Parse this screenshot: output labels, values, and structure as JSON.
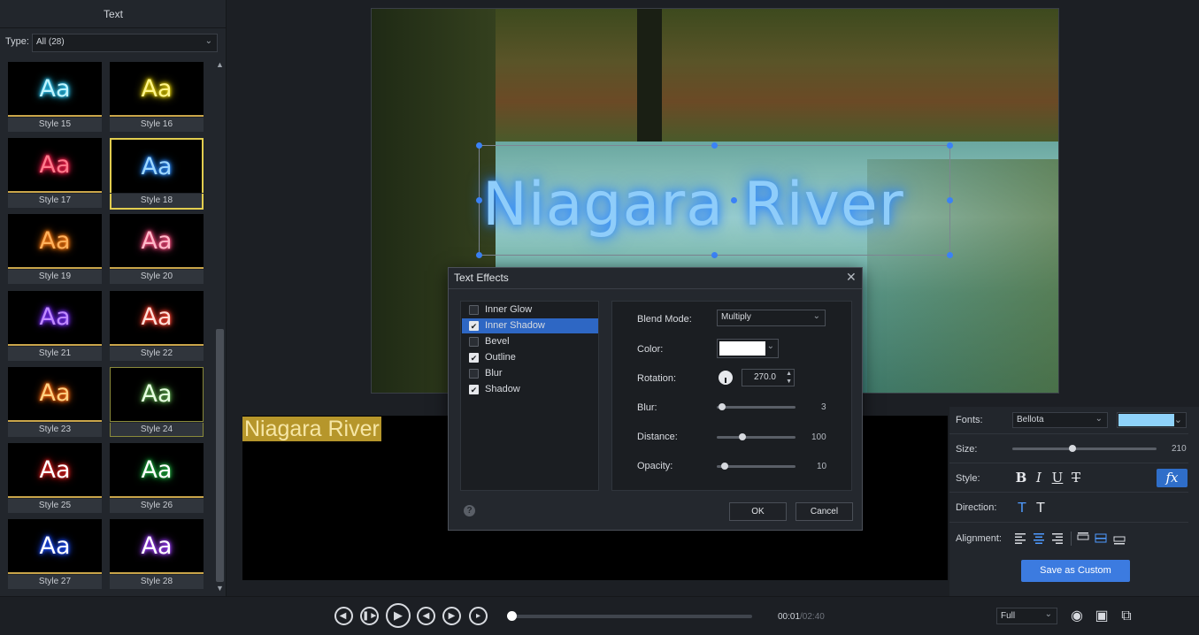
{
  "panel": {
    "title": "Text",
    "type_label": "Type:",
    "type_value": "All (28)"
  },
  "styles": [
    {
      "label": "Style 15",
      "glyph": "Aa",
      "fill": "#bff4ff",
      "glow": "#2fd0ff"
    },
    {
      "label": "Style 16",
      "glyph": "Aa",
      "fill": "#fff58a",
      "glow": "#e6d200"
    },
    {
      "label": "Style 17",
      "glyph": "Aa",
      "fill": "#ff7a8c",
      "glow": "#ff2050"
    },
    {
      "label": "Style 18",
      "glyph": "Aa",
      "fill": "#9fd8ff",
      "glow": "#2a8cff"
    },
    {
      "label": "Style 19",
      "glyph": "Aa",
      "fill": "#ffb05a",
      "glow": "#ff7a10"
    },
    {
      "label": "Style 20",
      "glyph": "Aa",
      "fill": "#ffb8c8",
      "glow": "#ff4d80"
    },
    {
      "label": "Style 21",
      "glyph": "Aa",
      "fill": "#c08aff",
      "glow": "#7a2dff"
    },
    {
      "label": "Style 22",
      "glyph": "Aa",
      "fill": "#ffe0d8",
      "glow": "#ff4030"
    },
    {
      "label": "Style 23",
      "glyph": "Aa",
      "fill": "#ffd080",
      "glow": "#ff6a10"
    },
    {
      "label": "Style 24",
      "glyph": "Aa",
      "fill": "#e6ffe0",
      "glow": "#58a04a"
    },
    {
      "label": "Style 25",
      "glyph": "Aa",
      "fill": "#ffffff",
      "glow": "#e02020"
    },
    {
      "label": "Style 26",
      "glyph": "Aa",
      "fill": "#ffffff",
      "glow": "#20b040"
    },
    {
      "label": "Style 27",
      "glyph": "Aa",
      "fill": "#ffffff",
      "glow": "#2050ff"
    },
    {
      "label": "Style 28",
      "glyph": "Aa",
      "fill": "#ffffff",
      "glow": "#a040ff"
    }
  ],
  "video": {
    "overlay_text": "Niagara River"
  },
  "timeline": {
    "clip_text": "Niagara River"
  },
  "properties": {
    "fonts_label": "Fonts:",
    "font_value": "Bellota",
    "text_color": "#8fd2fa",
    "size_label": "Size:",
    "size_value": "210",
    "size_fraction": 0.42,
    "style_label": "Style:",
    "bold": "B",
    "italic": "I",
    "underline": "U",
    "strike": "T",
    "fx": "fx",
    "direction_label": "Direction:",
    "alignment_label": "Alignment:",
    "save_custom": "Save as Custom"
  },
  "dialog": {
    "title": "Text Effects",
    "close": "✕",
    "effects": [
      {
        "label": "Inner Glow",
        "checked": false,
        "active": false
      },
      {
        "label": "Inner Shadow",
        "checked": true,
        "active": true
      },
      {
        "label": "Bevel",
        "checked": false,
        "active": false
      },
      {
        "label": "Outline",
        "checked": true,
        "active": false
      },
      {
        "label": "Blur",
        "checked": false,
        "active": false
      },
      {
        "label": "Shadow",
        "checked": true,
        "active": false
      }
    ],
    "blend_mode_label": "Blend Mode:",
    "blend_mode_value": "Multiply",
    "color_label": "Color:",
    "color_value": "#ffffff",
    "rotation_label": "Rotation:",
    "rotation_value": "270.0",
    "blur_label": "Blur:",
    "blur_value": "3",
    "blur_fraction": 0.03,
    "distance_label": "Distance:",
    "distance_value": "100",
    "distance_fraction": 0.33,
    "opacity_label": "Opacity:",
    "opacity_value": "10",
    "opacity_fraction": 0.1,
    "ok": "OK",
    "cancel": "Cancel",
    "help": "?"
  },
  "player": {
    "time_current": "00:01",
    "time_total": "/02:40",
    "progress_fraction": 0.0,
    "zoom_value": "Full"
  }
}
